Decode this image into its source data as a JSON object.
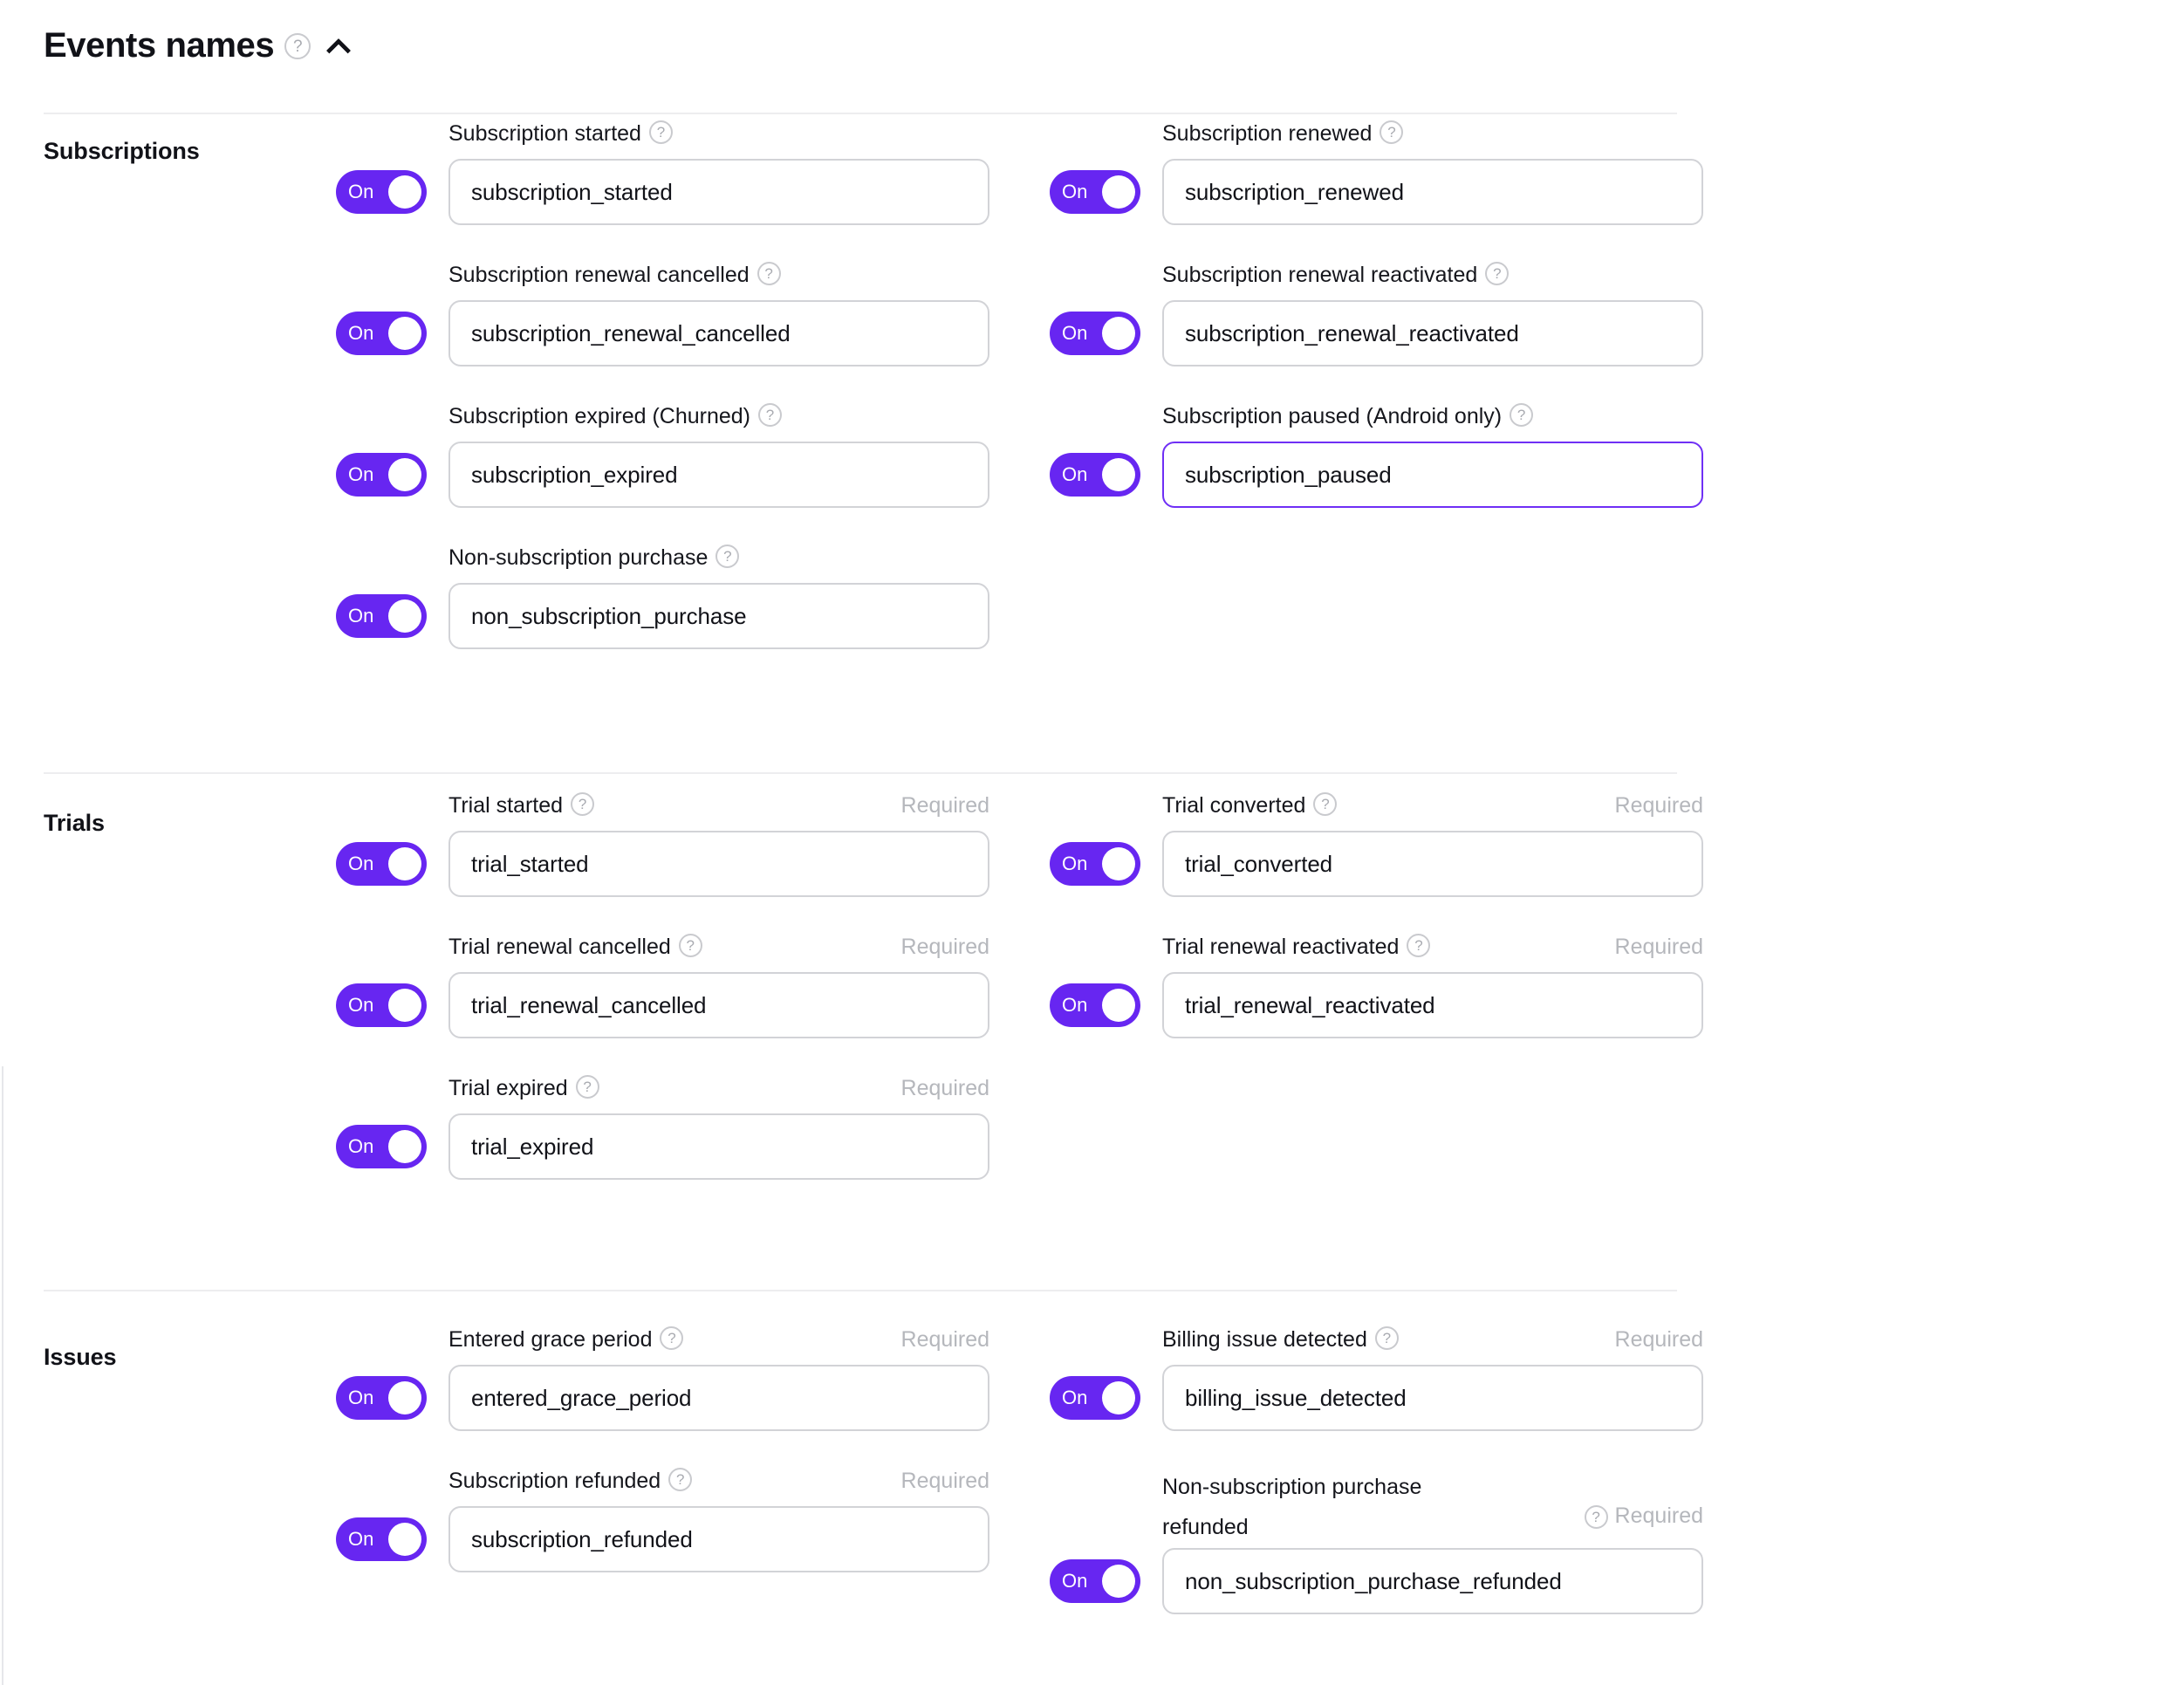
{
  "header": {
    "title": "Events names",
    "help_icon": "help-circle-icon",
    "collapse_icon": "chevron-up-icon",
    "collapsed": false
  },
  "labels": {
    "required": "Required",
    "toggle_on": "On"
  },
  "colors": {
    "accent": "#6726f1",
    "focus_border": "#6f2ff5",
    "border": "#d2d3d7",
    "divider": "#ededef",
    "muted_text": "#b5b7bc"
  },
  "groups": [
    {
      "name": "Subscriptions",
      "fields": [
        {
          "label": "Subscription started",
          "value": "subscription_started",
          "toggle": "On",
          "required": false,
          "focused": false,
          "column": "left",
          "row": 0
        },
        {
          "label": "Subscription renewed",
          "value": "subscription_renewed",
          "toggle": "On",
          "required": false,
          "focused": false,
          "column": "right",
          "row": 0
        },
        {
          "label": "Subscription renewal cancelled",
          "value": "subscription_renewal_cancelled",
          "toggle": "On",
          "required": false,
          "focused": false,
          "column": "left",
          "row": 1
        },
        {
          "label": "Subscription renewal reactivated",
          "value": "subscription_renewal_reactivated",
          "toggle": "On",
          "required": false,
          "focused": false,
          "column": "right",
          "row": 1
        },
        {
          "label": "Subscription expired (Churned)",
          "value": "subscription_expired",
          "toggle": "On",
          "required": false,
          "focused": false,
          "column": "left",
          "row": 2
        },
        {
          "label": "Subscription paused (Android only)",
          "value": "subscription_paused",
          "toggle": "On",
          "required": false,
          "focused": true,
          "column": "right",
          "row": 2
        },
        {
          "label": "Non-subscription purchase",
          "value": "non_subscription_purchase",
          "toggle": "On",
          "required": false,
          "focused": false,
          "column": "left",
          "row": 3
        }
      ]
    },
    {
      "name": "Trials",
      "fields": [
        {
          "label": "Trial started",
          "value": "trial_started",
          "toggle": "On",
          "required": true,
          "focused": false,
          "column": "left",
          "row": 0
        },
        {
          "label": "Trial converted",
          "value": "trial_converted",
          "toggle": "On",
          "required": true,
          "focused": false,
          "column": "right",
          "row": 0
        },
        {
          "label": "Trial renewal cancelled",
          "value": "trial_renewal_cancelled",
          "toggle": "On",
          "required": true,
          "focused": false,
          "column": "left",
          "row": 1
        },
        {
          "label": "Trial renewal reactivated",
          "value": "trial_renewal_reactivated",
          "toggle": "On",
          "required": true,
          "focused": false,
          "column": "right",
          "row": 1
        },
        {
          "label": "Trial expired",
          "value": "trial_expired",
          "toggle": "On",
          "required": true,
          "focused": false,
          "column": "left",
          "row": 2
        }
      ]
    },
    {
      "name": "Issues",
      "fields": [
        {
          "label": "Entered grace period",
          "value": "entered_grace_period",
          "toggle": "On",
          "required": true,
          "focused": false,
          "column": "left",
          "row": 0
        },
        {
          "label": "Billing issue detected",
          "value": "billing_issue_detected",
          "toggle": "On",
          "required": true,
          "focused": false,
          "column": "right",
          "row": 0
        },
        {
          "label": "Subscription refunded",
          "value": "subscription_refunded",
          "toggle": "On",
          "required": true,
          "focused": false,
          "column": "left",
          "row": 1
        },
        {
          "label": "Non-subscription purchase refunded",
          "value": "non_subscription_purchase_refunded",
          "toggle": "On",
          "required": true,
          "focused": false,
          "column": "right",
          "row": 1,
          "two_line": true
        }
      ]
    }
  ]
}
